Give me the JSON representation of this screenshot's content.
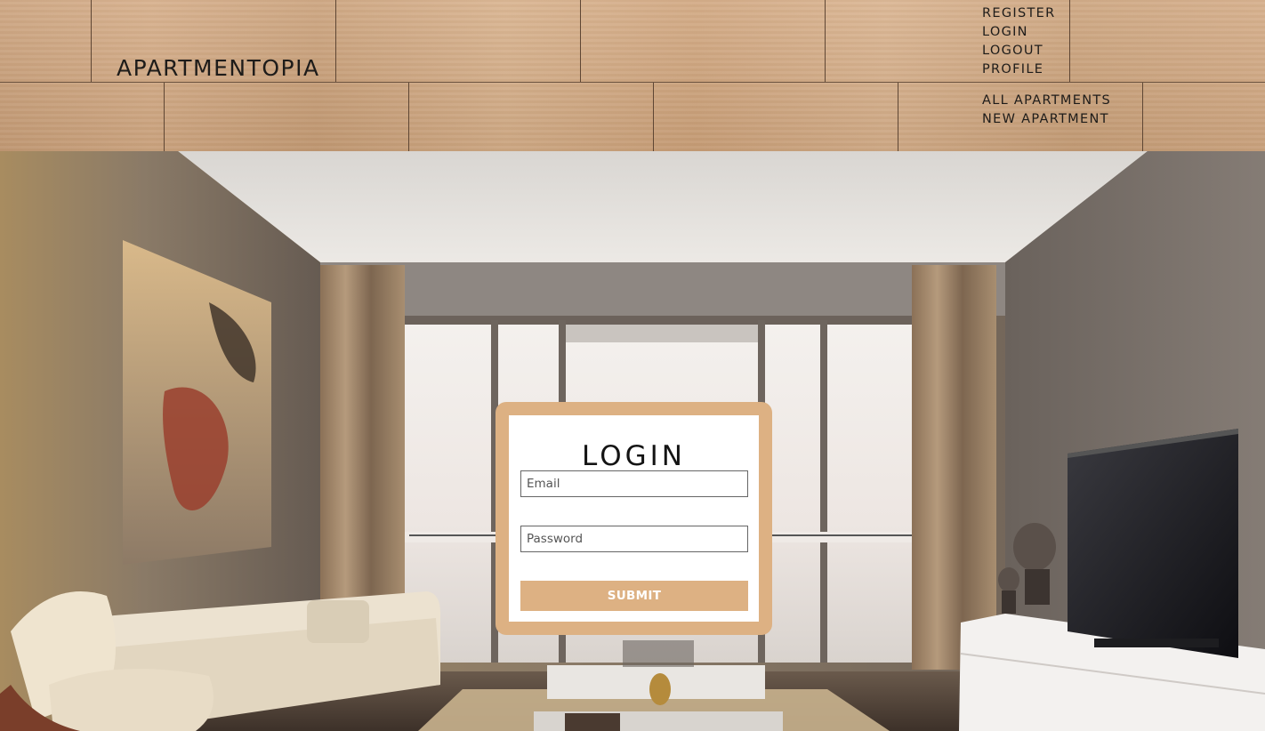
{
  "brand": {
    "title": "APARTMENTOPIA"
  },
  "nav": {
    "user_links": [
      "REGISTER",
      "LOGIN",
      "LOGOUT",
      "PROFILE"
    ],
    "apartment_links": [
      "ALL APARTMENTS",
      "NEW APARTMENT"
    ]
  },
  "login": {
    "title": "LOGIN",
    "email_placeholder": "Email",
    "password_placeholder": "Password",
    "submit_label": "SUBMIT"
  },
  "colors": {
    "accent": "#ddb183",
    "header_wood": "#d0a67f",
    "text_dark": "#1e1c1a"
  }
}
